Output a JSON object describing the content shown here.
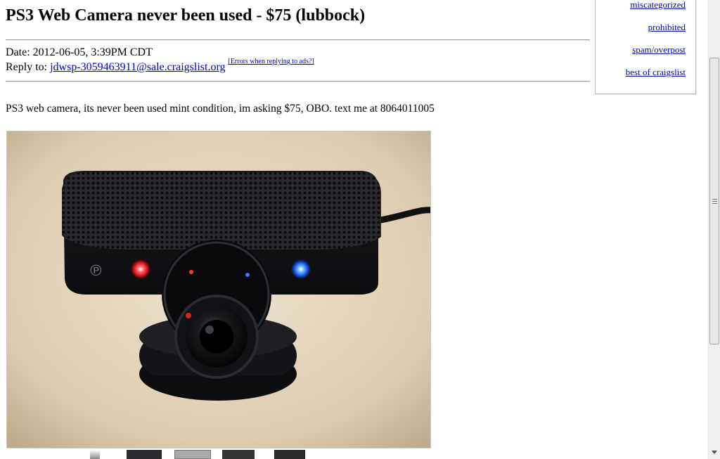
{
  "posting": {
    "title": "PS3 Web Camera never been used - $75 (lubbock)",
    "date_label": "Date:",
    "date_value": "2012-06-05, 3:39PM CDT",
    "reply_label": "Reply to:",
    "reply_email": "jdwsp-3059463911@sale.craigslist.org",
    "errors_link": "[Errors when replying to ads?]",
    "body": "PS3 web camera, its never been used mint condition, im asking $75, OBO. text me at 8064011005"
  },
  "flag_box": {
    "links": [
      "miscategorized",
      "prohibited",
      "spam/overpost",
      "best of craigslist"
    ]
  },
  "colors": {
    "link": "#0000cc",
    "rule": "#9a9a9a",
    "box_border": "#bdbdbd"
  },
  "icons": {
    "photo": "ps3-eye-camera-photo",
    "scroll_arrow": "chevron-down-icon"
  }
}
